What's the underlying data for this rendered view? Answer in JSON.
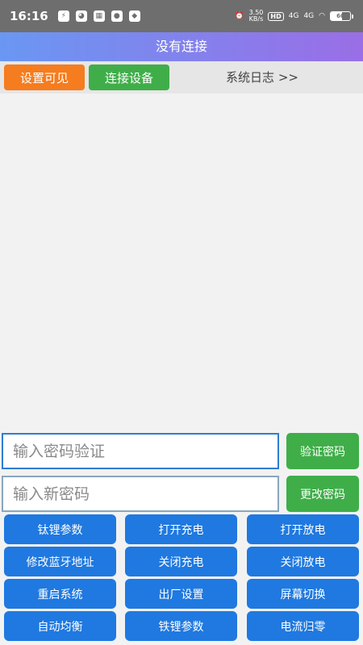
{
  "status_bar": {
    "time": "16:16",
    "speed_value": "3.50",
    "speed_unit": "KB/s",
    "hd_label": "HD",
    "signal1": "4G",
    "signal2": "4G",
    "battery_level": 60,
    "battery_text": "60"
  },
  "title": "没有连接",
  "toolbar": {
    "set_visible_label": "设置可见",
    "connect_label": "连接设备",
    "system_log_label": "系统日志 >>"
  },
  "password": {
    "verify_placeholder": "输入密码验证",
    "verify_button": "验证密码",
    "new_placeholder": "输入新密码",
    "change_button": "更改密码"
  },
  "buttons": [
    [
      "钛锂参数",
      "打开充电",
      "打开放电"
    ],
    [
      "修改蓝牙地址",
      "关闭充电",
      "关闭放电"
    ],
    [
      "重启系统",
      "出厂设置",
      "屏幕切换"
    ],
    [
      "自动均衡",
      "铁锂参数",
      "电流归零"
    ]
  ],
  "colors": {
    "orange": "#f57c1f",
    "green": "#3fae49",
    "blue": "#1f79e0"
  }
}
